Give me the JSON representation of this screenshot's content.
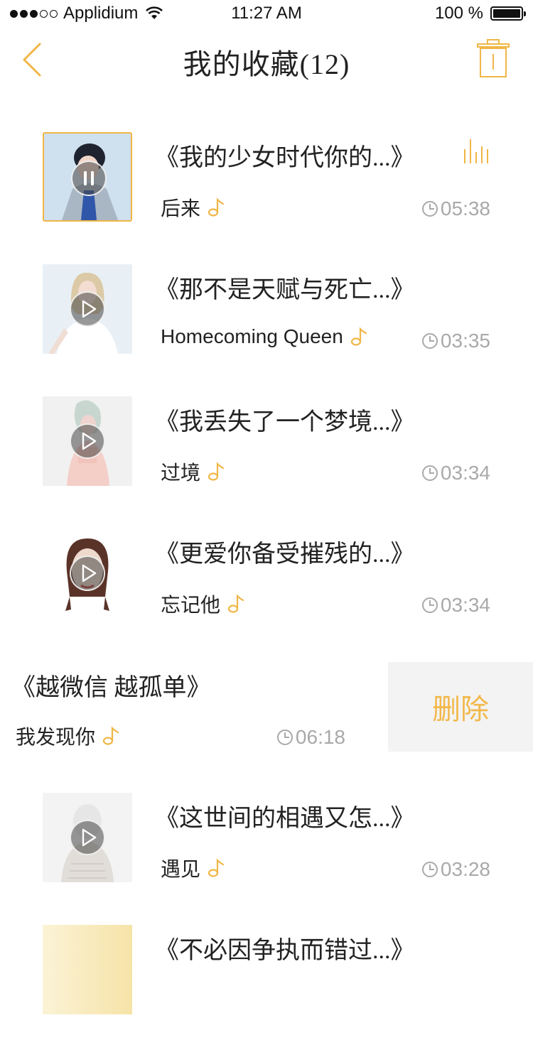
{
  "status_bar": {
    "carrier": "Applidium",
    "time": "11:27 AM",
    "battery": "100 %"
  },
  "nav": {
    "title": "我的收藏(12)"
  },
  "accent": "#f0b646",
  "songs": [
    {
      "title": "《我的少女时代你的...》",
      "artist": "后来",
      "duration": "05:38"
    },
    {
      "title": "《那不是天赋与死亡...》",
      "artist": "Homecoming Queen",
      "duration": "03:35"
    },
    {
      "title": "《我丢失了一个梦境...》",
      "artist": "过境",
      "duration": "03:34"
    },
    {
      "title": "《更爱你备受摧残的...》",
      "artist": "忘记他",
      "duration": "03:34"
    },
    {
      "title": "《这世间的相遇又怎...》",
      "artist": "遇见",
      "duration": "03:28"
    },
    {
      "title": "《不必因争执而错过...》",
      "artist": "",
      "duration": ""
    }
  ],
  "swiped": {
    "title": "《越微信  越孤单》",
    "artist": "我发现你",
    "duration": "06:18",
    "delete_label": "删除"
  }
}
